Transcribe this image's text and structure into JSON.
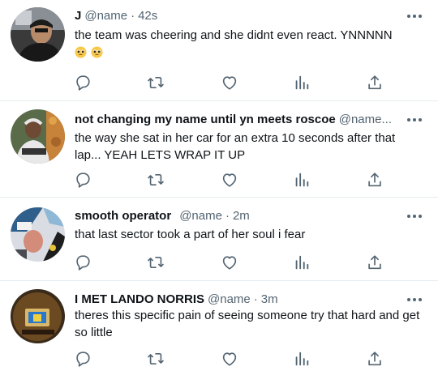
{
  "tweets": [
    {
      "display_name": "J",
      "handle": "@name",
      "separator": "·",
      "time": "42s",
      "text": "the team was cheering and she didnt even react. YNNNNN",
      "emoji": [
        "pleading-face-emoji",
        "pleading-face-emoji"
      ]
    },
    {
      "display_name": "not changing my name until yn meets roscoe",
      "handle": "@name...",
      "separator": "",
      "time": "",
      "text": "the way she sat in her car for an extra 10 seconds after that lap... YEAH LETS WRAP IT UP"
    },
    {
      "display_name": "smooth operator",
      "handle": "@name",
      "separator": "·",
      "time": "2m",
      "text": "that last sector took a part of her soul i fear"
    },
    {
      "display_name": "I MET LANDO NORRIS",
      "handle": "@name",
      "separator": "·",
      "time": "3m",
      "text": "theres this specific pain of seeing someone try that hard and get so little"
    }
  ],
  "actions": {
    "icons": [
      "reply-icon",
      "retweet-icon",
      "like-icon",
      "views-icon",
      "share-icon"
    ]
  },
  "colors": {
    "text": "#0f1419",
    "secondary": "#536471",
    "divider": "#e6ecf0",
    "icon": "#536471"
  }
}
